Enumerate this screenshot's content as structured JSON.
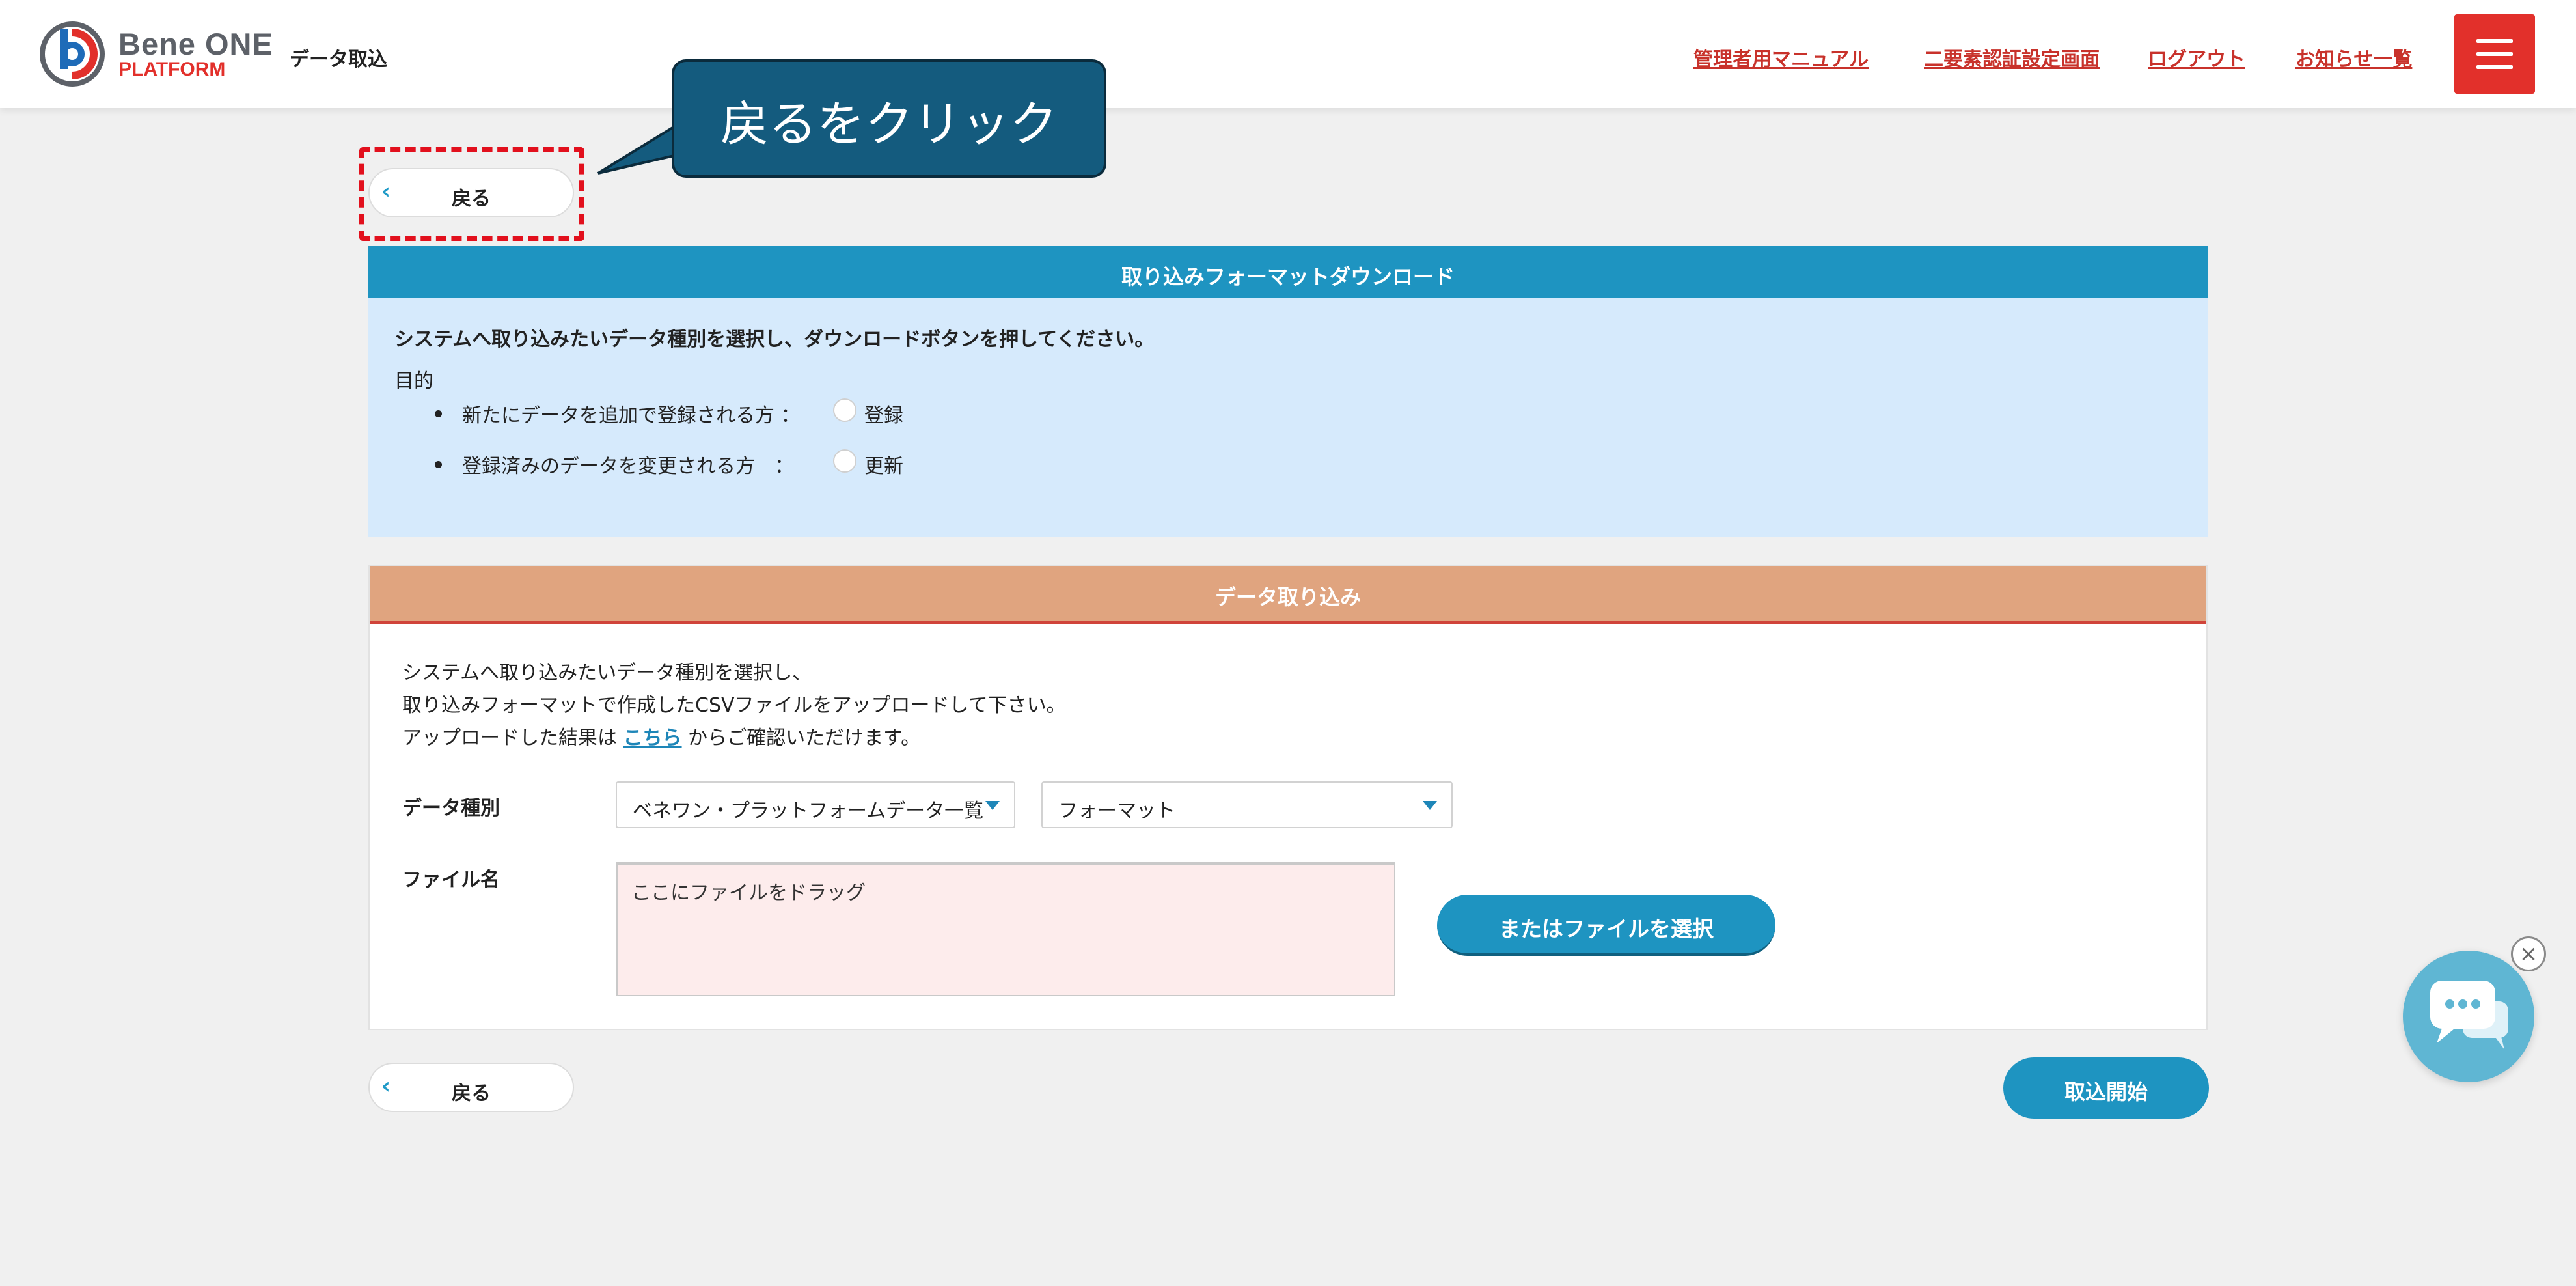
{
  "header": {
    "logo_line1": "Bene ONE",
    "logo_line2": "PLATFORM",
    "page_title": "データ取込",
    "nav": {
      "manual": "管理者用マニュアル",
      "two_factor": "二要素認証設定画面",
      "logout": "ログアウト",
      "news": "お知らせ一覧"
    }
  },
  "back_label": "戻る",
  "callout": "戻るをクリック",
  "format_section": {
    "title": "取り込みフォーマットダウンロード",
    "instruction": "システムへ取り込みたいデータ種別を選択し、ダウンロードボタンを押してください。",
    "purpose_label": "目的",
    "options": [
      {
        "desc": "新たにデータを追加で登録される方 ：",
        "label": "登録"
      },
      {
        "desc": "登録済みのデータを変更される方　：",
        "label": "更新"
      }
    ]
  },
  "import_section": {
    "title": "データ取り込み",
    "line1": "システムへ取り込みたいデータ種別を選択し、",
    "line2": "取り込みフォーマットで作成したCSVファイルをアップロードして下さい。",
    "line3_pre": "アップロードした結果は",
    "line3_link": "こちら",
    "line3_post": "からご確認いただけます。",
    "data_type_label": "データ種別",
    "data_type_value": "ベネワン・プラットフォームデータ一覧",
    "format_value": "フォーマット",
    "file_label": "ファイル名",
    "drop_placeholder": "ここにファイルをドラッグ",
    "file_button": "またはファイルを選択"
  },
  "start_button": "取込開始",
  "colors": {
    "brand_red": "#e2302b",
    "primary_blue": "#1e94c1",
    "section_orange": "#e0a47f",
    "callout_navy": "#145b7e"
  },
  "icons": [
    "logo-icon",
    "menu-icon",
    "chevron-left-icon",
    "chat-icon",
    "close-icon"
  ]
}
